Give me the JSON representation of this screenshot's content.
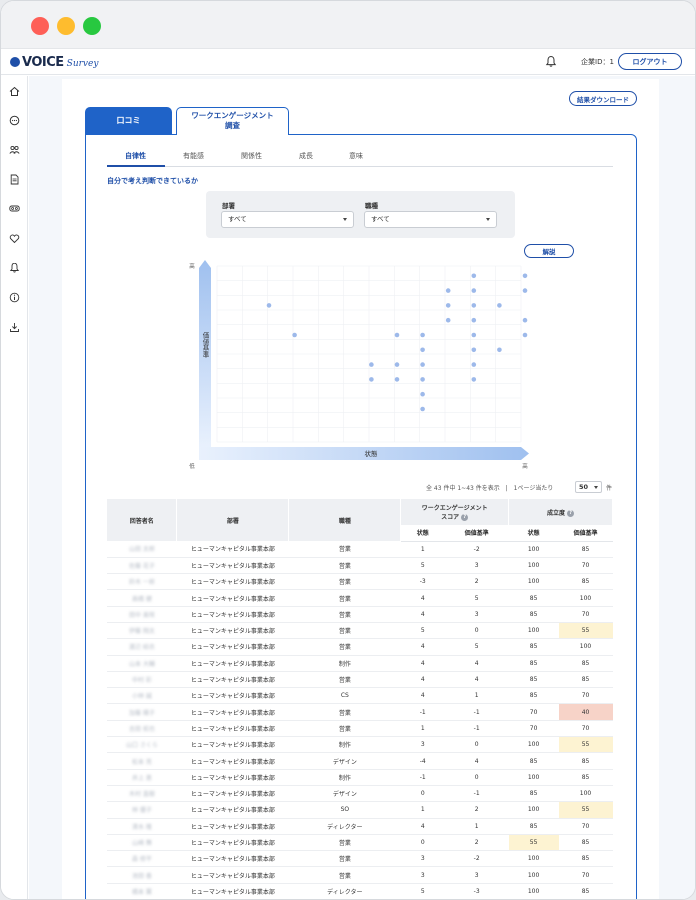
{
  "header": {
    "logo_main": "VOICE",
    "logo_sub": "Survey",
    "company_id": "企業ID：1",
    "logout_label": "ログアウト"
  },
  "sidebar": {
    "icons": [
      "home-icon",
      "chat-icon",
      "people-icon",
      "document-icon",
      "vr-icon",
      "heart-icon",
      "bell-icon",
      "info-icon",
      "download-icon"
    ]
  },
  "page": {
    "download_label": "結果ダウンロード",
    "tabs": [
      {
        "label": "口コミ"
      },
      {
        "label": "ワークエンゲージメント\n調査"
      }
    ],
    "subtabs": [
      "自律性",
      "有能感",
      "関係性",
      "成長",
      "意味"
    ],
    "question": "自分で考え判断できているか",
    "filters": {
      "department_label": "部署",
      "department_value": "すべて",
      "job_label": "職種",
      "job_value": "すべて"
    },
    "explain_label": "解説"
  },
  "chart_data": {
    "type": "scatter",
    "xlabel": "状態",
    "ylabel": "価値基準",
    "x_low_label": "低",
    "x_high_label": "高",
    "y_low_label": "低",
    "y_high_label": "高",
    "grid": true,
    "points": [
      [
        -4,
        4
      ],
      [
        -3,
        2
      ],
      [
        0,
        0
      ],
      [
        0,
        -1
      ],
      [
        1,
        2
      ],
      [
        1,
        0
      ],
      [
        1,
        -1
      ],
      [
        2,
        2
      ],
      [
        2,
        1
      ],
      [
        2,
        0
      ],
      [
        2,
        -1
      ],
      [
        2,
        -2
      ],
      [
        2,
        -3
      ],
      [
        3,
        5
      ],
      [
        3,
        4
      ],
      [
        3,
        3
      ],
      [
        4,
        6
      ],
      [
        4,
        5
      ],
      [
        4,
        4
      ],
      [
        4,
        3
      ],
      [
        4,
        2
      ],
      [
        4,
        1
      ],
      [
        4,
        0
      ],
      [
        4,
        -1
      ],
      [
        5,
        4
      ],
      [
        5,
        1
      ],
      [
        6,
        6
      ],
      [
        6,
        5
      ],
      [
        6,
        3
      ],
      [
        6,
        2
      ],
      [
        7,
        3
      ],
      [
        7,
        1
      ],
      [
        7,
        -2
      ]
    ]
  },
  "pagination": {
    "count_text": "全 43 件中 1~43 件を表示",
    "separator": "|",
    "per_page_label": "1ページ当たり",
    "per_page_value": "50",
    "unit": "件"
  },
  "table": {
    "headers": {
      "name": "回答者名",
      "department": "部署",
      "job": "職種",
      "score": "ワークエンゲージメント\nスコア",
      "achievement": "成立度",
      "state": "状態",
      "value": "価値基準"
    },
    "rows": [
      {
        "name": "山田 太郎",
        "department": "ヒューマンキャピタル事業本部",
        "job": "営業",
        "s_state": "1",
        "s_value": "-2",
        "a_state": "100",
        "a_value": "85",
        "hl_state": "",
        "hl_value": ""
      },
      {
        "name": "佐藤 花子",
        "department": "ヒューマンキャピタル事業本部",
        "job": "営業",
        "s_state": "5",
        "s_value": "3",
        "a_state": "100",
        "a_value": "70",
        "hl_state": "",
        "hl_value": ""
      },
      {
        "name": "鈴木 一郎",
        "department": "ヒューマンキャピタル事業本部",
        "job": "営業",
        "s_state": "-3",
        "s_value": "2",
        "a_state": "100",
        "a_value": "85",
        "hl_state": "",
        "hl_value": ""
      },
      {
        "name": "高橋 健",
        "department": "ヒューマンキャピタル事業本部",
        "job": "営業",
        "s_state": "4",
        "s_value": "5",
        "a_state": "85",
        "a_value": "100",
        "hl_state": "",
        "hl_value": ""
      },
      {
        "name": "田中 美咲",
        "department": "ヒューマンキャピタル事業本部",
        "job": "営業",
        "s_state": "4",
        "s_value": "3",
        "a_state": "85",
        "a_value": "70",
        "hl_state": "",
        "hl_value": ""
      },
      {
        "name": "伊藤 翔太",
        "department": "ヒューマンキャピタル事業本部",
        "job": "営業",
        "s_state": "5",
        "s_value": "0",
        "a_state": "100",
        "a_value": "55",
        "hl_state": "",
        "hl_value": "y"
      },
      {
        "name": "渡辺 結衣",
        "department": "ヒューマンキャピタル事業本部",
        "job": "営業",
        "s_state": "4",
        "s_value": "5",
        "a_state": "85",
        "a_value": "100",
        "hl_state": "",
        "hl_value": ""
      },
      {
        "name": "山本 大輔",
        "department": "ヒューマンキャピタル事業本部",
        "job": "制作",
        "s_state": "4",
        "s_value": "4",
        "a_state": "85",
        "a_value": "85",
        "hl_state": "",
        "hl_value": ""
      },
      {
        "name": "中村 彩",
        "department": "ヒューマンキャピタル事業本部",
        "job": "営業",
        "s_state": "4",
        "s_value": "4",
        "a_state": "85",
        "a_value": "85",
        "hl_state": "",
        "hl_value": ""
      },
      {
        "name": "小林 誠",
        "department": "ヒューマンキャピタル事業本部",
        "job": "CS",
        "s_state": "4",
        "s_value": "1",
        "a_state": "85",
        "a_value": "70",
        "hl_state": "",
        "hl_value": ""
      },
      {
        "name": "加藤 陽子",
        "department": "ヒューマンキャピタル事業本部",
        "job": "営業",
        "s_state": "-1",
        "s_value": "-1",
        "a_state": "70",
        "a_value": "40",
        "hl_state": "",
        "hl_value": "r"
      },
      {
        "name": "吉田 拓也",
        "department": "ヒューマンキャピタル事業本部",
        "job": "営業",
        "s_state": "1",
        "s_value": "-1",
        "a_state": "70",
        "a_value": "70",
        "hl_state": "",
        "hl_value": ""
      },
      {
        "name": "山口 さくら",
        "department": "ヒューマンキャピタル事業本部",
        "job": "制作",
        "s_state": "3",
        "s_value": "0",
        "a_state": "100",
        "a_value": "55",
        "hl_state": "",
        "hl_value": "y"
      },
      {
        "name": "松本 亮",
        "department": "ヒューマンキャピタル事業本部",
        "job": "デザイン",
        "s_state": "-4",
        "s_value": "4",
        "a_state": "85",
        "a_value": "85",
        "hl_state": "",
        "hl_value": ""
      },
      {
        "name": "井上 恵",
        "department": "ヒューマンキャピタル事業本部",
        "job": "制作",
        "s_state": "-1",
        "s_value": "0",
        "a_state": "100",
        "a_value": "85",
        "hl_state": "",
        "hl_value": ""
      },
      {
        "name": "木村 直樹",
        "department": "ヒューマンキャピタル事業本部",
        "job": "デザイン",
        "s_state": "0",
        "s_value": "-1",
        "a_state": "85",
        "a_value": "100",
        "hl_state": "",
        "hl_value": ""
      },
      {
        "name": "林 優子",
        "department": "ヒューマンキャピタル事業本部",
        "job": "SO",
        "s_state": "1",
        "s_value": "2",
        "a_state": "100",
        "a_value": "55",
        "hl_state": "",
        "hl_value": "y"
      },
      {
        "name": "清水 隆",
        "department": "ヒューマンキャピタル事業本部",
        "job": "ディレクター",
        "s_state": "4",
        "s_value": "1",
        "a_state": "85",
        "a_value": "70",
        "hl_state": "",
        "hl_value": ""
      },
      {
        "name": "山崎 舞",
        "department": "ヒューマンキャピタル事業本部",
        "job": "営業",
        "s_state": "0",
        "s_value": "2",
        "a_state": "55",
        "a_value": "85",
        "hl_state": "y",
        "hl_value": ""
      },
      {
        "name": "森 修平",
        "department": "ヒューマンキャピタル事業本部",
        "job": "営業",
        "s_state": "3",
        "s_value": "-2",
        "a_state": "100",
        "a_value": "85",
        "hl_state": "",
        "hl_value": ""
      },
      {
        "name": "池田 香",
        "department": "ヒューマンキャピタル事業本部",
        "job": "営業",
        "s_state": "3",
        "s_value": "3",
        "a_state": "100",
        "a_value": "70",
        "hl_state": "",
        "hl_value": ""
      },
      {
        "name": "橋本 翼",
        "department": "ヒューマンキャピタル事業本部",
        "job": "ディレクター",
        "s_state": "5",
        "s_value": "-3",
        "a_state": "100",
        "a_value": "85",
        "hl_state": "",
        "hl_value": ""
      }
    ]
  },
  "colors": {
    "primary": "#1f63c8",
    "accent": "#1f4fa8",
    "dot": "#9db9ea",
    "highlight_yellow": "#fdf3d2",
    "highlight_red": "#f7d3c8"
  }
}
